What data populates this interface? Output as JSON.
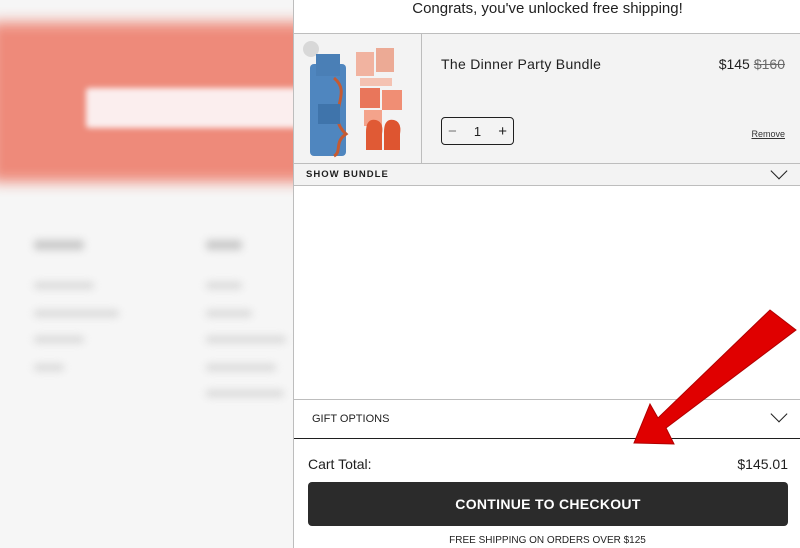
{
  "banner": {
    "text": "Congrats, you've unlocked free shipping!"
  },
  "cart_item": {
    "title": "The Dinner Party Bundle",
    "price": "$145",
    "original_price": "$160",
    "quantity": "1",
    "minus_label": "−",
    "plus_label": "+",
    "remove_label": "Remove"
  },
  "bundle": {
    "label": "SHOW BUNDLE"
  },
  "gift": {
    "label": "GIFT OPTIONS"
  },
  "totals": {
    "label": "Cart Total:",
    "value": "$145.01"
  },
  "checkout": {
    "label": "CONTINUE TO CHECKOUT"
  },
  "shipping_note": "FREE SHIPPING ON ORDERS OVER $125",
  "colors": {
    "accent_bg": "#ee8a7a",
    "button": "#2b2b2b",
    "arrow": "#e00000"
  },
  "icons": {
    "dropdown": "chevron-down-icon"
  }
}
